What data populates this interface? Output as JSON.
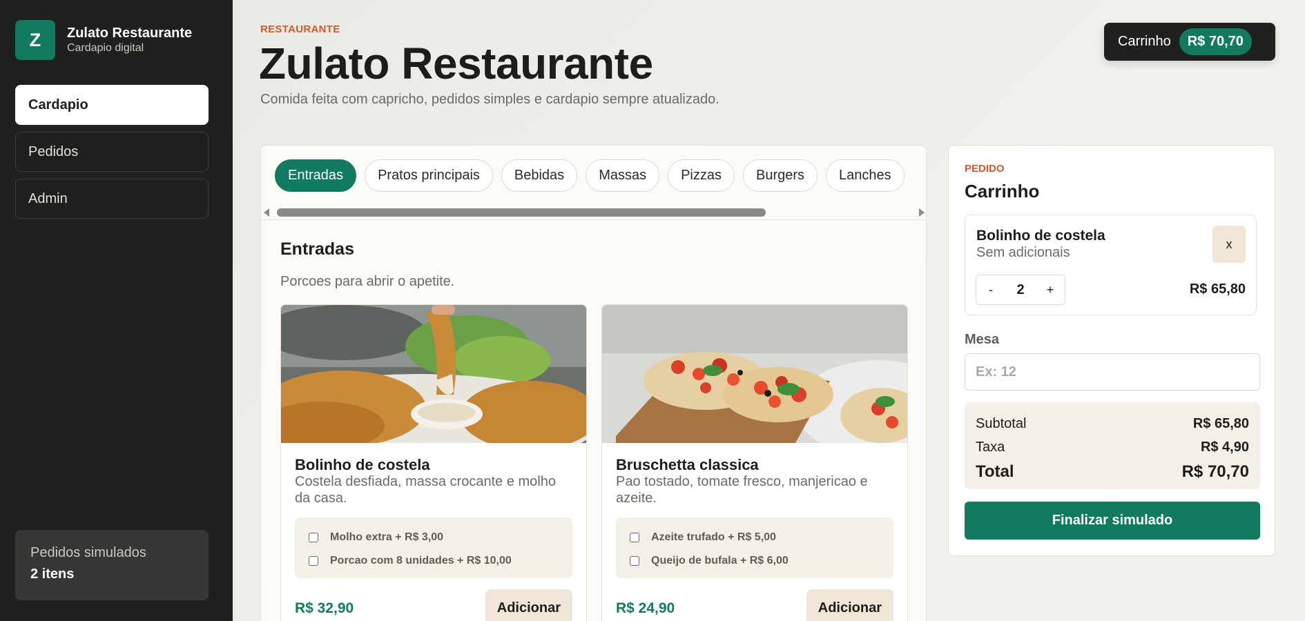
{
  "sidebar": {
    "logo_letter": "Z",
    "brand_name": "Zulato Restaurante",
    "brand_sub": "Cardapio digital",
    "nav": [
      "Cardapio",
      "Pedidos",
      "Admin"
    ],
    "sim_label": "Pedidos simulados",
    "sim_value": "2 itens"
  },
  "header": {
    "eyebrow": "RESTAURANTE",
    "title": "Zulato Restaurante",
    "subtitle": "Comida feita com capricho, pedidos simples e cardapio sempre atualizado.",
    "cart_label": "Carrinho",
    "cart_total": "R$ 70,70"
  },
  "menu": {
    "tabs": [
      "Entradas",
      "Pratos principais",
      "Bebidas",
      "Massas",
      "Pizzas",
      "Burgers",
      "Lanches"
    ],
    "section_title": "Entradas",
    "section_sub": "Porcoes para abrir o apetite.",
    "add_label": "Adicionar",
    "items": [
      {
        "name": "Bolinho de costela",
        "desc": "Costela desfiada, massa crocante e molho da casa.",
        "addons": [
          "Molho extra + R$ 3,00",
          "Porcao com 8 unidades + R$ 10,00"
        ],
        "price": "R$ 32,90"
      },
      {
        "name": "Bruschetta classica",
        "desc": "Pao tostado, tomate fresco, manjericao e azeite.",
        "addons": [
          "Azeite trufado + R$ 5,00",
          "Queijo de bufala + R$ 6,00"
        ],
        "price": "R$ 24,90"
      }
    ]
  },
  "cart": {
    "eyebrow": "PEDIDO",
    "title": "Carrinho",
    "item": {
      "name": "Bolinho de costela",
      "sub": "Sem adicionais",
      "remove": "x",
      "minus": "-",
      "qty": "2",
      "plus": "+",
      "price": "R$ 65,80"
    },
    "mesa_label": "Mesa",
    "mesa_placeholder": "Ex: 12",
    "subtotal_label": "Subtotal",
    "subtotal": "R$ 65,80",
    "taxa_label": "Taxa",
    "taxa": "R$ 4,90",
    "total_label": "Total",
    "total": "R$ 70,70",
    "finalize": "Finalizar simulado"
  },
  "colors": {
    "accent": "#127a5e",
    "eyebrow": "#d2572c",
    "sidebar_bg": "#1f211f"
  }
}
